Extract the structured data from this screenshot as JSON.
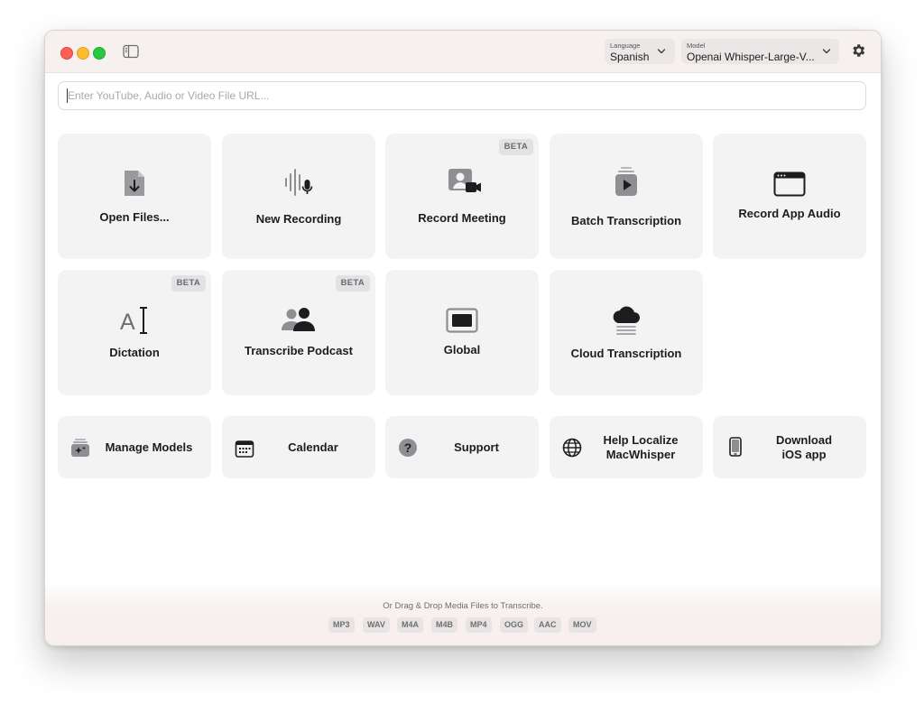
{
  "toolbar": {
    "language_label": "Language",
    "language_value": "Spanish",
    "model_label": "Model",
    "model_value": "Openai Whisper-Large-V..."
  },
  "url_input": {
    "placeholder": "Enter YouTube, Audio or Video File URL...",
    "value": ""
  },
  "actions": [
    {
      "label": "Open Files...",
      "icon": "file-download-icon",
      "badge": ""
    },
    {
      "label": "New Recording",
      "icon": "waveform-mic-icon",
      "badge": ""
    },
    {
      "label": "Record Meeting",
      "icon": "meeting-video-icon",
      "badge": "BETA"
    },
    {
      "label": "Batch Transcription",
      "icon": "stacked-play-icon",
      "badge": ""
    },
    {
      "label": "Record App Audio",
      "icon": "app-window-icon",
      "badge": ""
    },
    {
      "label": "Dictation",
      "icon": "text-cursor-icon",
      "badge": "BETA"
    },
    {
      "label": "Transcribe Podcast",
      "icon": "people-icon",
      "badge": "BETA"
    },
    {
      "label": "Global",
      "icon": "screen-icon",
      "badge": ""
    },
    {
      "label": "Cloud Transcription",
      "icon": "cloud-icon",
      "badge": ""
    }
  ],
  "utilities": [
    {
      "label": "Manage Models",
      "icon": "sparkle-box-icon"
    },
    {
      "label": "Calendar",
      "icon": "calendar-icon"
    },
    {
      "label": "Support",
      "icon": "question-icon"
    },
    {
      "label": "Help Localize MacWhisper",
      "line1": "Help Localize",
      "line2": "MacWhisper",
      "icon": "globe-icon"
    },
    {
      "label": "Download iOS app",
      "line1": "Download",
      "line2": "iOS app",
      "icon": "phone-icon"
    }
  ],
  "drop": {
    "text": "Or Drag & Drop Media Files to Transcribe.",
    "formats": [
      "MP3",
      "WAV",
      "M4A",
      "M4B",
      "MP4",
      "OGG",
      "AAC",
      "MOV"
    ]
  },
  "colors": {
    "titlebar": "#f6f1ef",
    "card": "#f3f3f4",
    "badge": "#e2e2e4",
    "close": "#fe5f57",
    "minimize": "#febc2e",
    "zoom": "#28c840"
  }
}
